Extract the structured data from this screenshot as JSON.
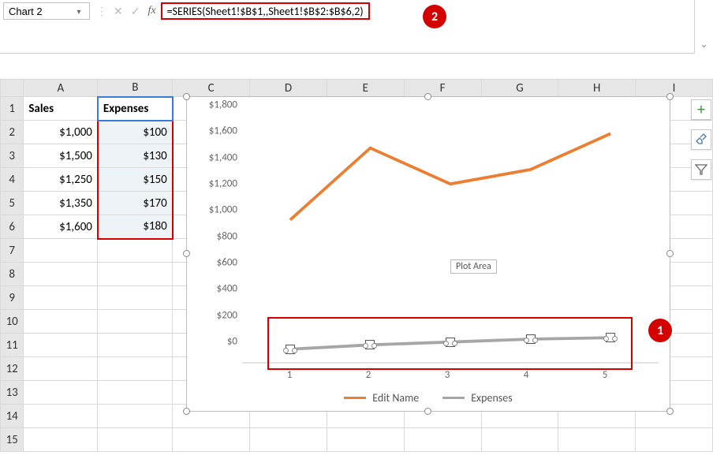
{
  "namebox": {
    "value": "Chart 2"
  },
  "formula": {
    "value": "=SERIES(Sheet1!$B$1,,Sheet1!$B$2:$B$6,2)"
  },
  "fx_label": "fx",
  "columns": [
    "A",
    "B",
    "C",
    "D",
    "E",
    "F",
    "G",
    "H",
    "I"
  ],
  "rows_visible": 15,
  "table": {
    "headers": {
      "a": "Sales",
      "b": "Expenses"
    },
    "rows": [
      {
        "a": "$1,000",
        "b": "$100"
      },
      {
        "a": "$1,500",
        "b": "$130"
      },
      {
        "a": "$1,250",
        "b": "$150"
      },
      {
        "a": "$1,350",
        "b": "$170"
      },
      {
        "a": "$1,600",
        "b": "$180"
      }
    ]
  },
  "callouts": {
    "formula": "2",
    "series": "1"
  },
  "plot_area_tooltip": "Plot Area",
  "chart_data": {
    "type": "line",
    "categories": [
      1,
      2,
      3,
      4,
      5
    ],
    "series": [
      {
        "name": "Edit Name",
        "values": [
          1000,
          1500,
          1250,
          1350,
          1600
        ],
        "color": "#ed7d31"
      },
      {
        "name": "Expenses",
        "values": [
          100,
          130,
          150,
          170,
          180
        ],
        "color": "#a6a6a6",
        "selected": true
      }
    ],
    "ylim": [
      0,
      1800
    ],
    "ystep": 200,
    "yticks": [
      "$0",
      "$200",
      "$400",
      "$600",
      "$800",
      "$1,000",
      "$1,200",
      "$1,400",
      "$1,600",
      "$1,800"
    ],
    "xlabel": "",
    "ylabel": "",
    "title": ""
  },
  "side_buttons": {
    "plus": "+",
    "brush": "brush-icon",
    "filter": "filter-icon"
  }
}
